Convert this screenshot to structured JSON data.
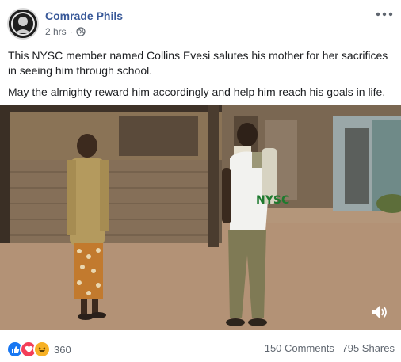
{
  "post": {
    "author": "Comrade Phils",
    "time": "2 hrs",
    "time_sep": "·",
    "privacy_icon": "globe-icon",
    "more_icon": "more-options-icon",
    "paragraphs": [
      "This NYSC member named Collins Evesi salutes his mother for her sacrifices in seeing him through school.",
      "May the almighty reward him accordingly and help him reach his goals in life."
    ]
  },
  "video": {
    "volume_icon": "volume-icon",
    "uniform_text": "NYSC"
  },
  "footer": {
    "reactions": [
      "like-icon",
      "love-icon",
      "haha-icon"
    ],
    "reaction_count": "360",
    "comments": "150 Comments",
    "shares": "795 Shares"
  },
  "colors": {
    "author": "#385898",
    "like": "#1877f2",
    "love": "#f33e58",
    "haha": "#f7b125"
  }
}
